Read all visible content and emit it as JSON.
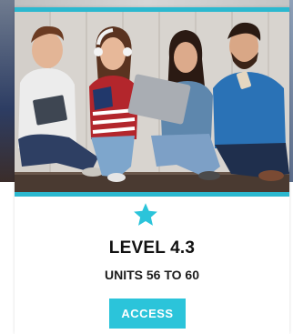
{
  "card": {
    "level_title": "LEVEL 4.3",
    "units_label": "UNITS 56 TO 60",
    "action_label": "ACCESS",
    "icon": "star-icon",
    "photo": "four-students-with-devices-image"
  },
  "colors": {
    "accent": "#2bc4da",
    "accent_bar": "#2bb8cf",
    "title_text": "#111111"
  }
}
